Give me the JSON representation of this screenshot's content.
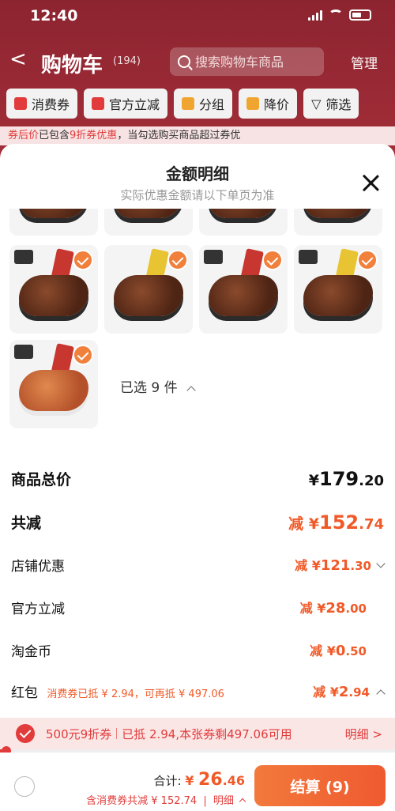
{
  "status_bar": {
    "time": "12:40"
  },
  "nav": {
    "back_glyph": "<",
    "title": "购物车",
    "count": "(194)",
    "search_placeholder": "搜索购物车商品",
    "manage": "管理"
  },
  "filters": [
    {
      "label": "消费券",
      "icon": "coupon-icon",
      "color": "#e23b3b"
    },
    {
      "label": "官方立减",
      "icon": "lightning-icon",
      "color": "#e23b3b"
    },
    {
      "label": "分组",
      "icon": "folder-icon",
      "color": "#f1a531"
    },
    {
      "label": "降价",
      "icon": "down-arrow-icon",
      "color": "#f1a531"
    },
    {
      "label": "筛选",
      "icon": "filter-icon",
      "color": "#333333"
    }
  ],
  "banner": {
    "lead": "券后价",
    "text": "已包含",
    "highlight": "9折券优惠",
    "rest": "，当勾选购买商品超过券优"
  },
  "sheet": {
    "title": "金额明细",
    "subtitle": "实际优惠金额请以下单页为准",
    "selected_count": "已选 9 件",
    "details": {
      "goods_total": {
        "label": "商品总价",
        "yen": "¥",
        "int": "179",
        "dec": ".20"
      },
      "total_reduce": {
        "label": "共减",
        "prefix": "减 ",
        "yen": "¥",
        "int": "152",
        "dec": ".74"
      },
      "shop_discount": {
        "label": "店铺优惠",
        "prefix": "减 ",
        "yen": "¥",
        "int": "121",
        "dec": ".30"
      },
      "official_reduce": {
        "label": "官方立减",
        "prefix": "减 ",
        "yen": "¥",
        "int": "28",
        "dec": ".00"
      },
      "taojin_coin": {
        "label": "淘金币",
        "prefix": "减 ",
        "yen": "¥",
        "int": "0",
        "dec": ".50"
      },
      "red_packet": {
        "label": "红包",
        "note": "消费券已抵 ¥ 2.94，可再抵 ¥ 497.06",
        "prefix": "减 ",
        "yen": "¥",
        "int": "2",
        "dec": ".94"
      }
    }
  },
  "coupon_bar": {
    "left": "500元9折券",
    "right": "已抵 2.94,本张券剩497.06可用",
    "link": "明细 >",
    "progress": 0.006
  },
  "footer": {
    "total_label": "合计: ",
    "yen": "¥ ",
    "amount": "26",
    "amount_dec": ".46",
    "sub": "含消费券共减 ¥ 152.74",
    "sub_link": "明细",
    "checkout": "结算 (9)"
  },
  "colors": {
    "accent": "#f05a28",
    "brand_red": "#e23b3b",
    "check_orange": "#f0803c"
  }
}
